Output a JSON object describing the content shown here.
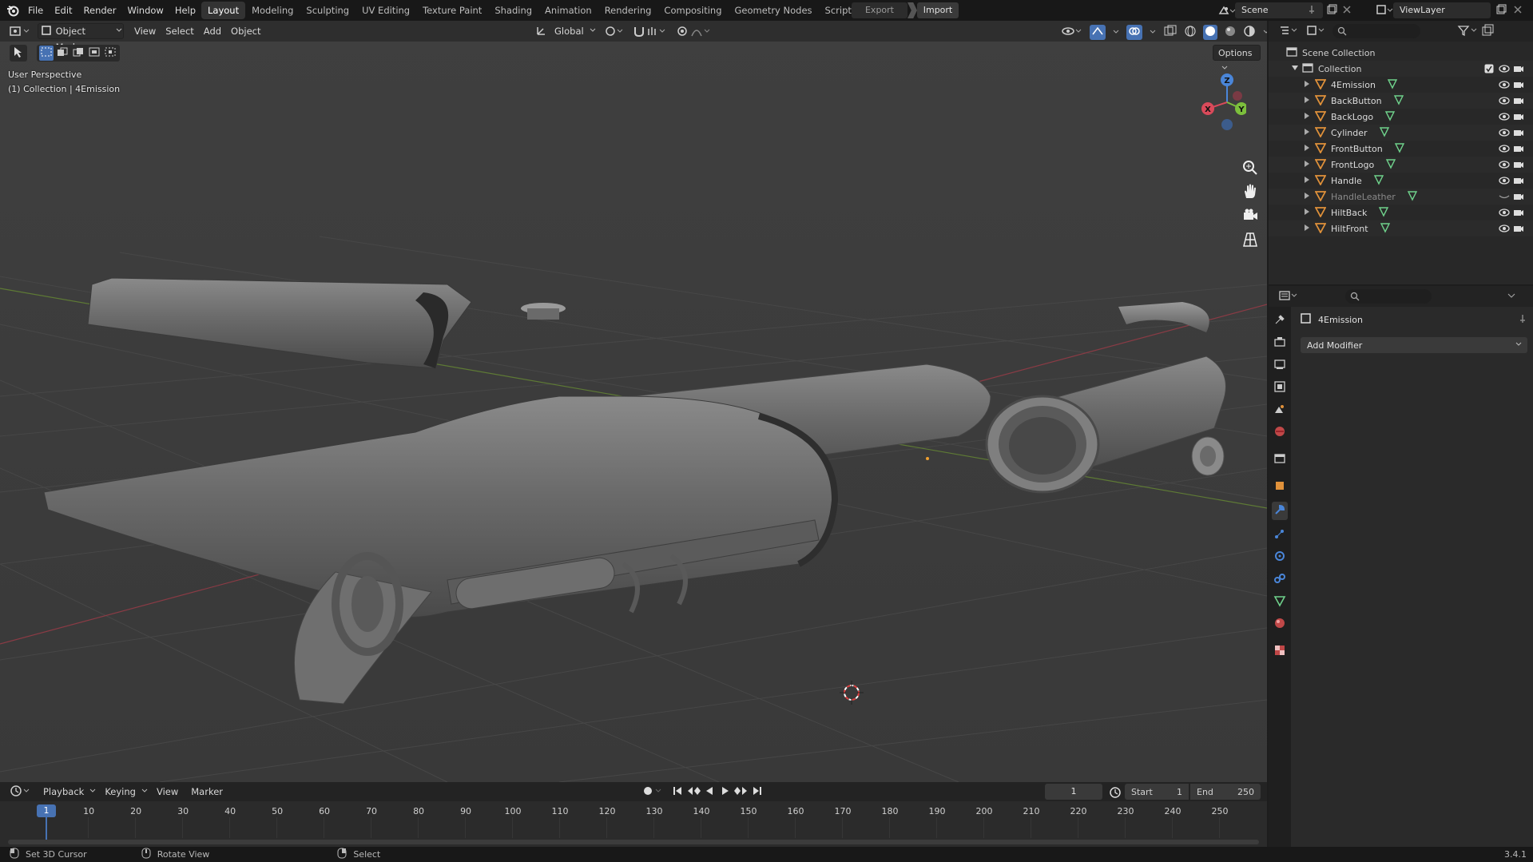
{
  "topbar": {
    "menus": [
      "File",
      "Edit",
      "Render",
      "Window",
      "Help"
    ],
    "workspaces": [
      "Layout",
      "Modeling",
      "Sculpting",
      "UV Editing",
      "Texture Paint",
      "Shading",
      "Animation",
      "Rendering",
      "Compositing",
      "Geometry Nodes",
      "Scripting"
    ],
    "active_workspace": "Layout",
    "add_workspace": "+",
    "export_label": "Export",
    "import_label": "Import",
    "scene_name": "Scene",
    "view_layer": "ViewLayer"
  },
  "viewport_header": {
    "mode": "Object Mode",
    "menus": [
      "View",
      "Select",
      "Add",
      "Object"
    ],
    "transform_orientation": "Global",
    "options_label": "Options"
  },
  "viewport": {
    "perspective_label": "User Perspective",
    "context_label": "(1) Collection | 4Emission",
    "gizmo_axes": {
      "x": "X",
      "y": "Y",
      "z": "Z"
    }
  },
  "outliner": {
    "scene_collection": "Scene Collection",
    "collection": "Collection",
    "objects": [
      {
        "name": "4Emission",
        "visible": true
      },
      {
        "name": "BackButton",
        "visible": true
      },
      {
        "name": "BackLogo",
        "visible": true
      },
      {
        "name": "Cylinder",
        "visible": true
      },
      {
        "name": "FrontButton",
        "visible": true
      },
      {
        "name": "FrontLogo",
        "visible": true
      },
      {
        "name": "Handle",
        "visible": true
      },
      {
        "name": "HandleLeather",
        "visible": false
      },
      {
        "name": "HiltBack",
        "visible": true
      },
      {
        "name": "HiltFront",
        "visible": true
      }
    ]
  },
  "properties": {
    "object_name": "4Emission",
    "add_modifier_label": "Add Modifier"
  },
  "timeline": {
    "menus": [
      "Playback",
      "Keying",
      "View",
      "Marker"
    ],
    "current_frame": "1",
    "start_label": "Start",
    "start_value": "1",
    "end_label": "End",
    "end_value": "250",
    "ruler_ticks": [
      "10",
      "20",
      "30",
      "40",
      "50",
      "60",
      "70",
      "80",
      "90",
      "100",
      "110",
      "120",
      "130",
      "140",
      "150",
      "160",
      "170",
      "180",
      "190",
      "200",
      "210",
      "220",
      "230",
      "240",
      "250"
    ],
    "playhead_label": "1"
  },
  "statusbar": {
    "hint1": "Set 3D Cursor",
    "hint2": "Rotate View",
    "hint3": "Select",
    "version": "3.4.1"
  },
  "colors": {
    "accent_blue": "#4772b3",
    "object_orange": "#e0913a",
    "mesh_green": "#6fd18b",
    "axis_x": "#d94a5a",
    "axis_y": "#7cbf3c",
    "axis_z": "#4a86d9"
  }
}
